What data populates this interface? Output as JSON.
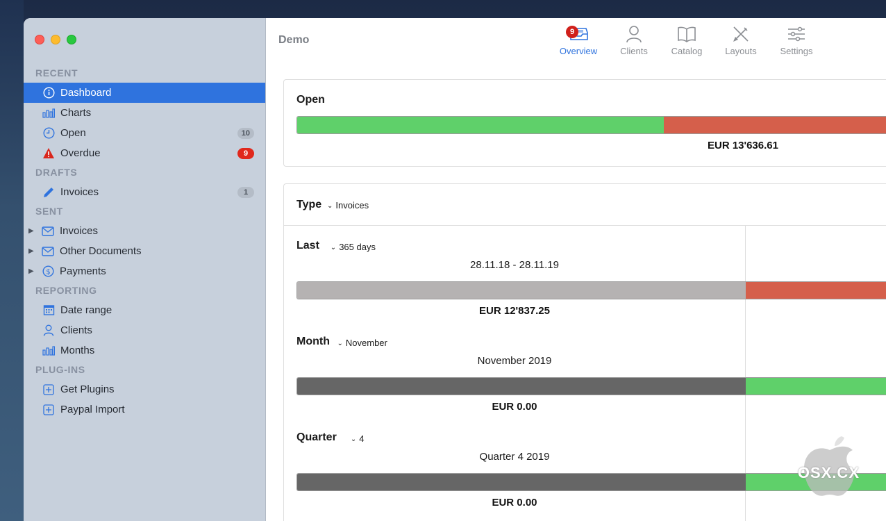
{
  "window": {
    "title": "Demo"
  },
  "sidebar": {
    "sections": [
      {
        "header": "RECENT",
        "items": [
          {
            "label": "Dashboard",
            "icon": "info-icon",
            "active": true
          },
          {
            "label": "Charts",
            "icon": "bar-chart-icon"
          },
          {
            "label": "Open",
            "icon": "clock-icon",
            "badge": "10"
          },
          {
            "label": "Overdue",
            "icon": "warning-icon",
            "badge": "9",
            "badge_color": "#e0281c"
          }
        ]
      },
      {
        "header": "DRAFTS",
        "items": [
          {
            "label": "Invoices",
            "icon": "pencil-icon",
            "badge": "1"
          }
        ]
      },
      {
        "header": "SENT",
        "items": [
          {
            "label": "Invoices",
            "icon": "envelope-icon",
            "disclosure": true
          },
          {
            "label": "Other Documents",
            "icon": "envelope-icon",
            "disclosure": true
          },
          {
            "label": "Payments",
            "icon": "dollar-icon",
            "disclosure": true
          }
        ]
      },
      {
        "header": "REPORTING",
        "items": [
          {
            "label": "Date range",
            "icon": "calendar-icon"
          },
          {
            "label": "Clients",
            "icon": "person-icon"
          },
          {
            "label": "Months",
            "icon": "bar-chart-icon"
          }
        ]
      },
      {
        "header": "PLUG-INS",
        "items": [
          {
            "label": "Get Plugins",
            "icon": "plus-square-icon"
          },
          {
            "label": "Paypal Import",
            "icon": "plus-square-icon"
          }
        ]
      }
    ]
  },
  "toolbar": {
    "overview": {
      "label": "Overview",
      "badge": "9"
    },
    "clients": {
      "label": "Clients"
    },
    "catalog": {
      "label": "Catalog"
    },
    "layouts": {
      "label": "Layouts"
    },
    "settings": {
      "label": "Settings"
    }
  },
  "open_card": {
    "title": "Open",
    "amount": "EUR 13'636.61",
    "segments": [
      {
        "color": "#5fd06a",
        "share": 0.62
      },
      {
        "color": "#d55f4b",
        "share": 0.38
      }
    ]
  },
  "type_card": {
    "type_label": "Type",
    "type_value": "Invoices",
    "rows": [
      {
        "label": "Last",
        "select": "365 days",
        "range": "28.11.18 - 28.11.19",
        "amount": "EUR 12'837.25",
        "left_color": "#b5b2b2",
        "right_color": "#d55f4b"
      },
      {
        "label": "Month",
        "select": "November",
        "range": "November 2019",
        "amount": "EUR 0.00",
        "left_color": "#666666",
        "right_color": "#5fd06a"
      },
      {
        "label": "Quarter",
        "select": "4",
        "range": "Quarter 4 2019",
        "amount": "EUR 0.00",
        "left_color": "#666666",
        "right_color": "#5fd06a"
      }
    ]
  },
  "watermark": {
    "text": "OSX.CX"
  }
}
